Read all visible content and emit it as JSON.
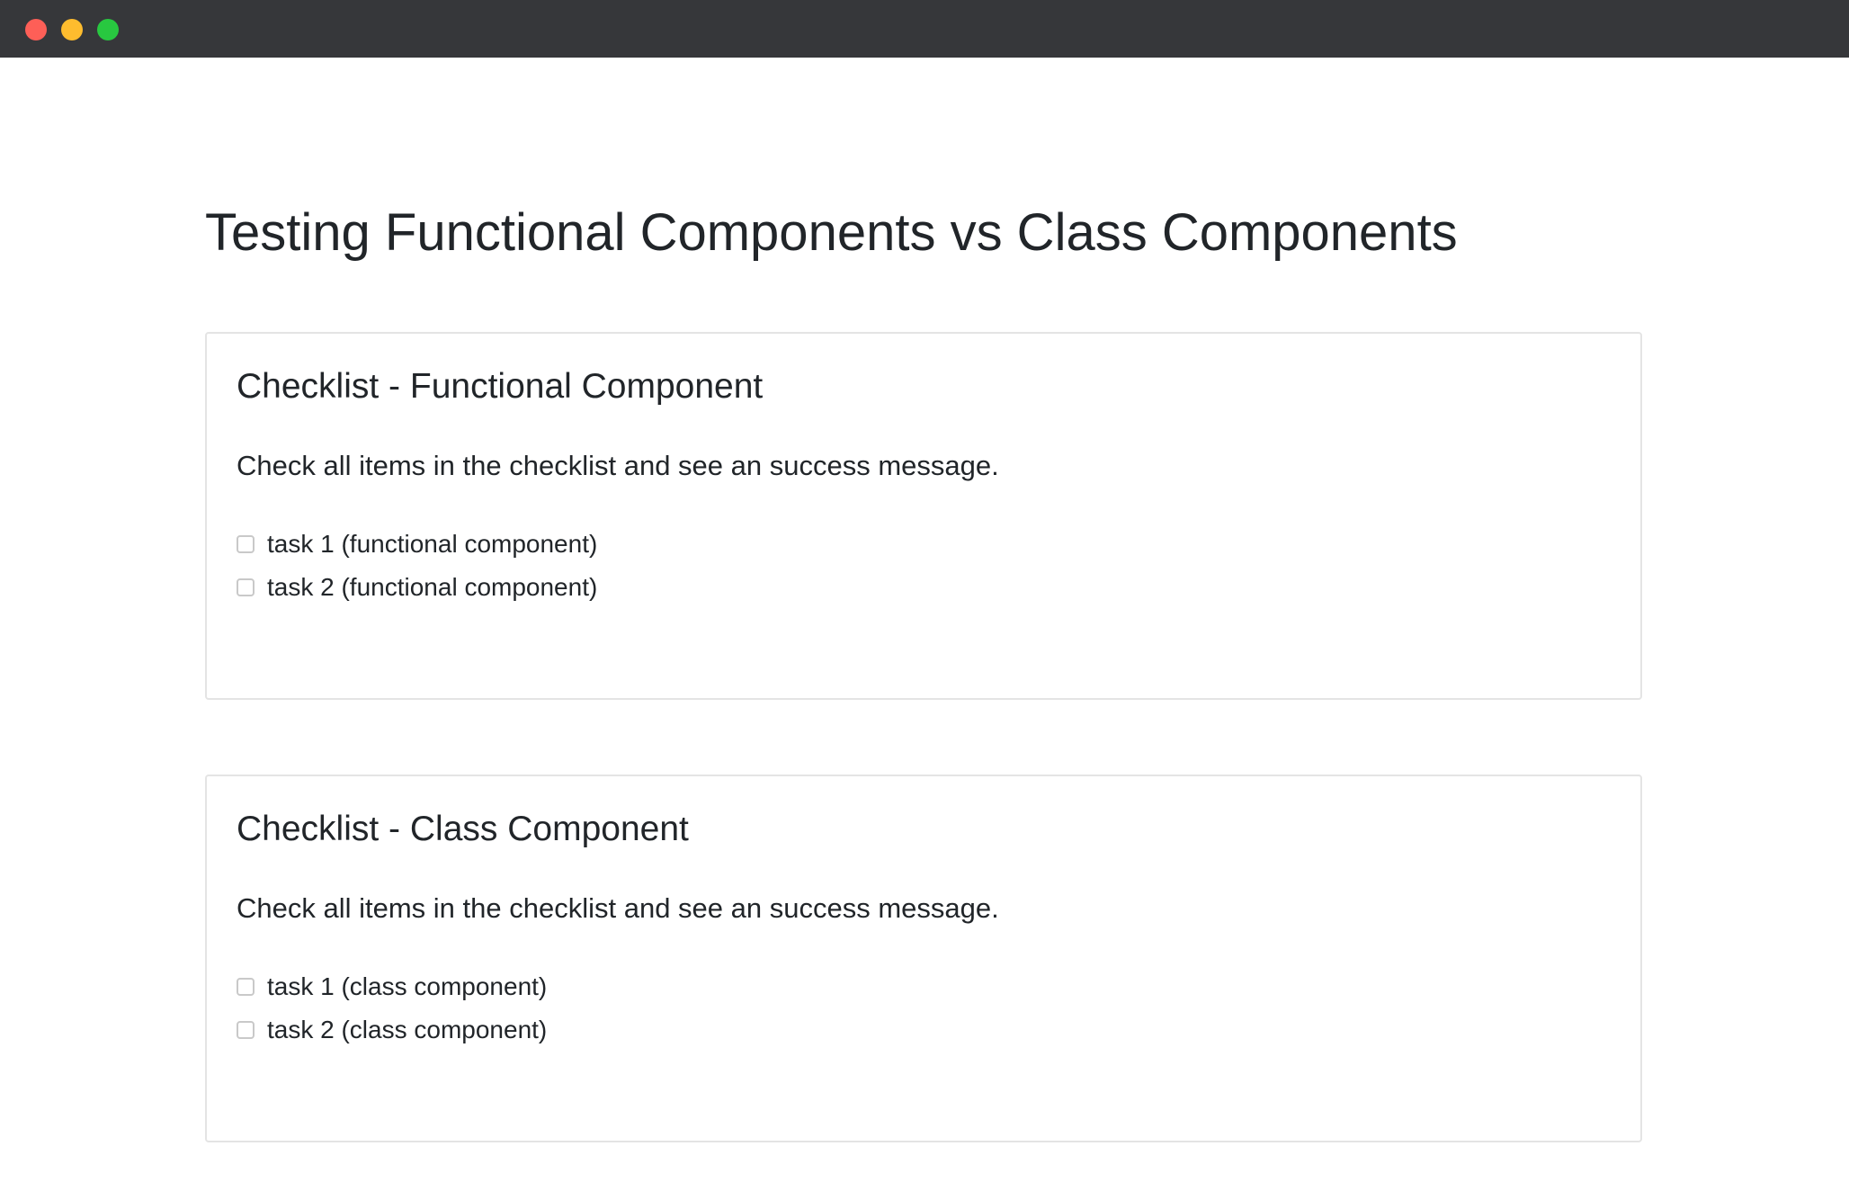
{
  "window": {
    "colors": {
      "titlebar": "#36373a",
      "close": "#fe5f57",
      "minimize": "#febc2e",
      "maximize": "#28c840"
    }
  },
  "page": {
    "title": "Testing Functional Components vs Class Components"
  },
  "checklists": [
    {
      "title": "Checklist - Functional Component",
      "description": "Check all items in the checklist and see an success message.",
      "tasks": [
        {
          "label": "task 1 (functional component)",
          "checked": false
        },
        {
          "label": "task 2 (functional component)",
          "checked": false
        }
      ]
    },
    {
      "title": "Checklist - Class Component",
      "description": "Check all items in the checklist and see an success message.",
      "tasks": [
        {
          "label": "task 1 (class component)",
          "checked": false
        },
        {
          "label": "task 2 (class component)",
          "checked": false
        }
      ]
    }
  ]
}
